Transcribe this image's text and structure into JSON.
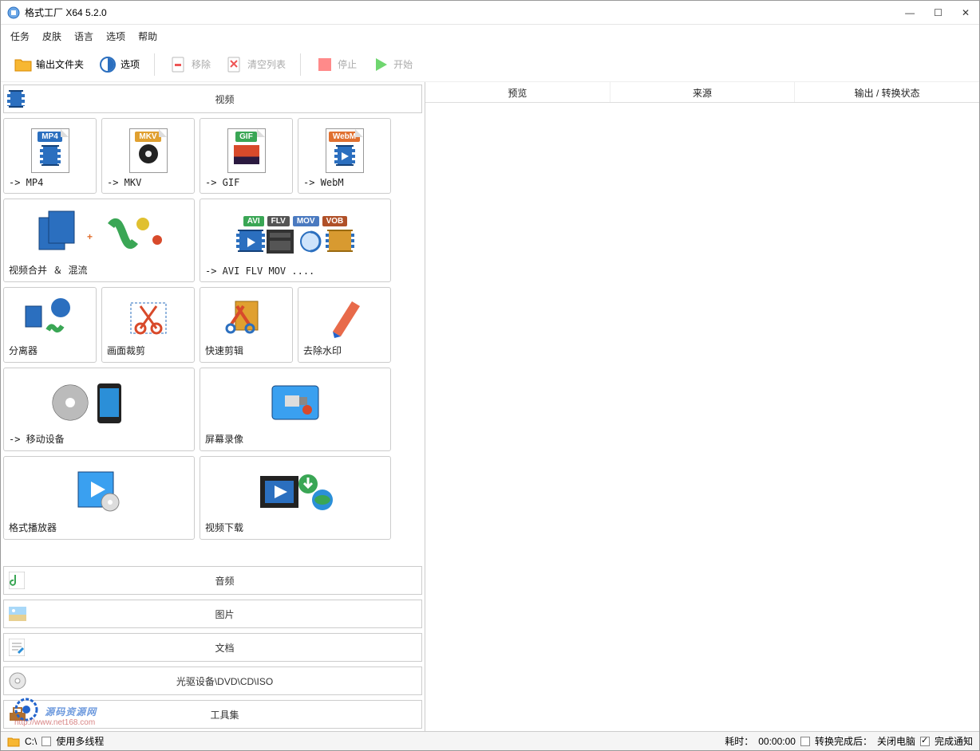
{
  "title": "格式工厂 X64 5.2.0",
  "menu": [
    "任务",
    "皮肤",
    "语言",
    "选项",
    "帮助"
  ],
  "toolbar": {
    "output_folder": "输出文件夹",
    "options": "选项",
    "remove": "移除",
    "clear_list": "清空列表",
    "stop": "停止",
    "start": "开始"
  },
  "categories": {
    "video": "视频",
    "audio": "音频",
    "image": "图片",
    "document": "文档",
    "dvd": "光驱设备\\DVD\\CD\\ISO",
    "tools": "工具集"
  },
  "tiles": {
    "mp4": "-> MP4",
    "mkv": "-> MKV",
    "gif": "-> GIF",
    "webm": "-> WebM",
    "merge": "视频合并 ＆ 混流",
    "avi": "-> AVI FLV MOV ....",
    "split": "分离器",
    "crop": "画面裁剪",
    "quick_edit": "快速剪辑",
    "dewatermark": "去除水印",
    "mobile": "-> 移动设备",
    "screen_rec": "屏幕录像",
    "player": "格式播放器",
    "download": "视频下载",
    "badge_mp4": "MP4",
    "badge_mkv": "MKV",
    "badge_gif": "GIF",
    "badge_webm": "WebM",
    "badge_avi": "AVI",
    "badge_flv": "FLV",
    "badge_mov": "MOV",
    "badge_vob": "VOB"
  },
  "list_headers": {
    "preview": "预览",
    "source": "来源",
    "status": "输出 / 转换状态"
  },
  "status": {
    "drive": "C:\\",
    "multithread": "使用多线程",
    "elapsed_label": "耗时：",
    "elapsed": "00:00:00",
    "after_label": "转换完成后：",
    "after_value": "关闭电脑",
    "notify": "完成通知"
  },
  "watermark": {
    "main": "源码资源网",
    "sub": "http://www.net168.com"
  }
}
